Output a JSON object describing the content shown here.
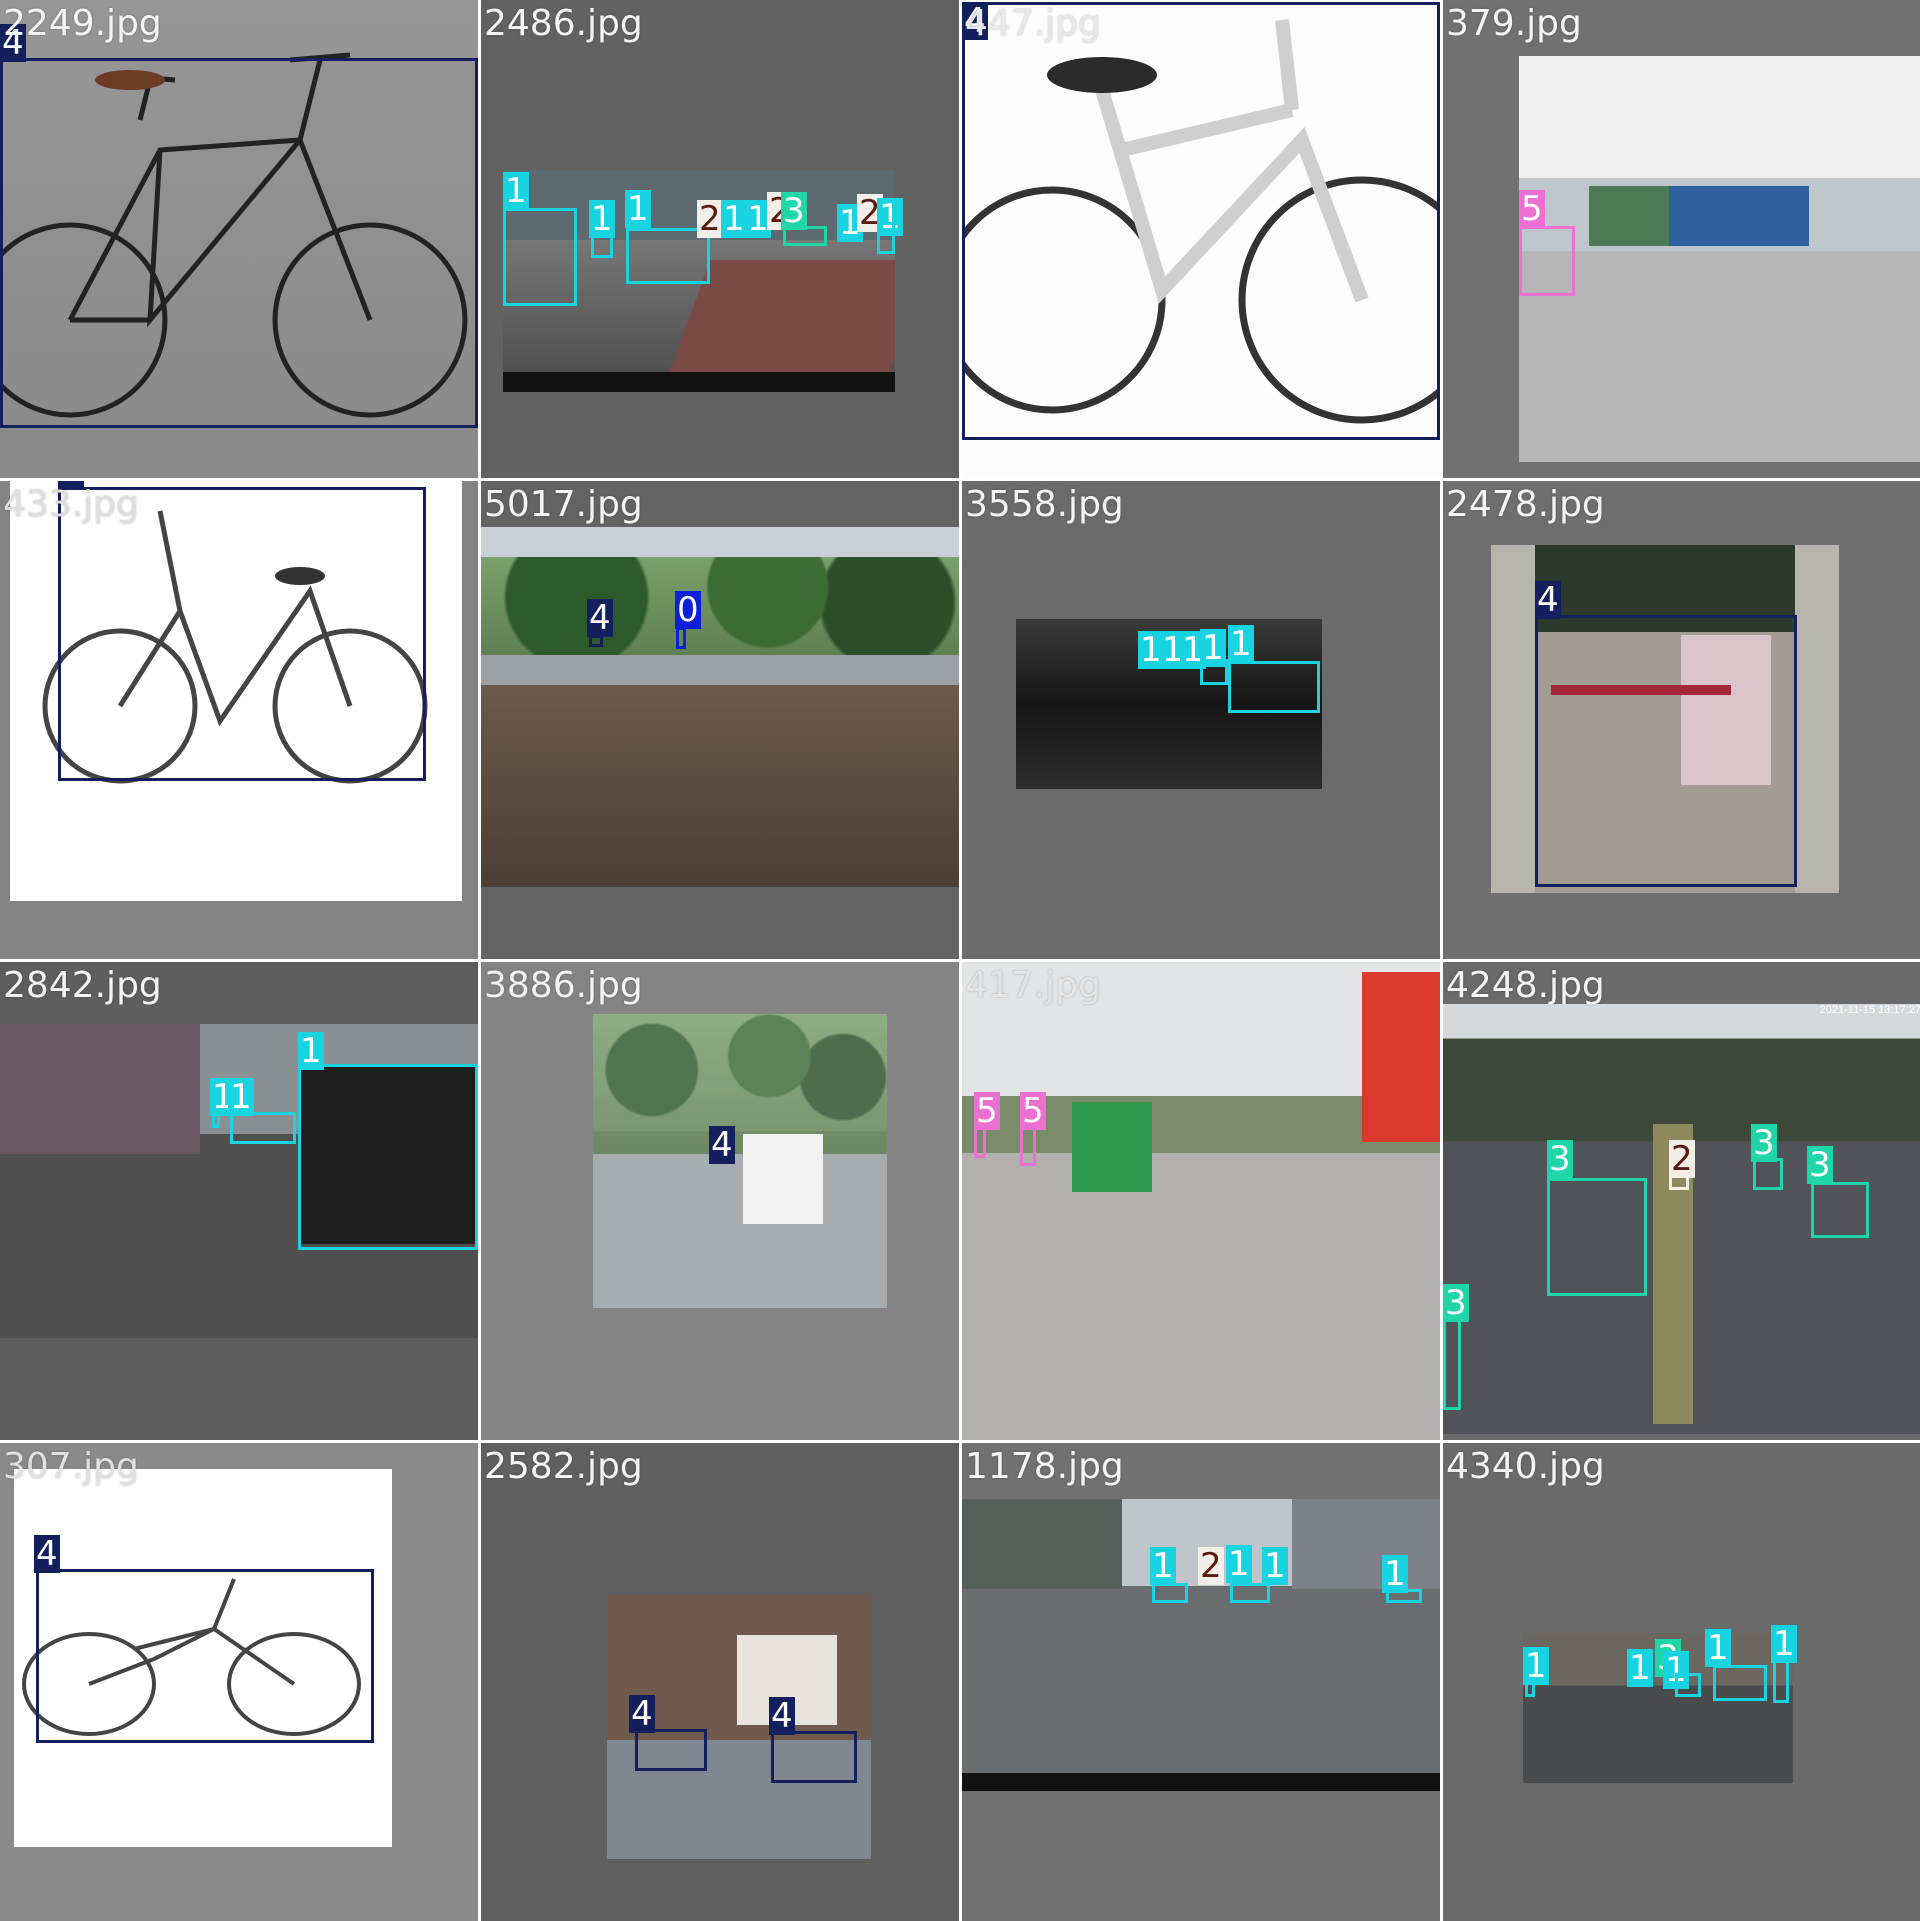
{
  "tiles": [
    {
      "name": "2249.jpg"
    },
    {
      "name": "2486.jpg"
    },
    {
      "name": "447.jpg"
    },
    {
      "name": "379.jpg"
    },
    {
      "name": "433.jpg"
    },
    {
      "name": "5017.jpg"
    },
    {
      "name": "3558.jpg"
    },
    {
      "name": "2478.jpg"
    },
    {
      "name": "2842.jpg"
    },
    {
      "name": "3886.jpg"
    },
    {
      "name": "417.jpg"
    },
    {
      "name": "4248.jpg"
    },
    {
      "name": "307.jpg"
    },
    {
      "name": "2582.jpg"
    },
    {
      "name": "1178.jpg"
    },
    {
      "name": "4340.jpg"
    }
  ],
  "class_labels": [
    "0",
    "1",
    "2",
    "3",
    "4",
    "5"
  ],
  "class_colors": {
    "0": "#0d1fd8",
    "1": "#18d3e0",
    "2": "#f2efe9",
    "3": "#1fd6a8",
    "4": "#14205e",
    "5": "#ec6fd2"
  },
  "overlay_texts": {
    "timestamp": "2021-11-15 13:17:27"
  }
}
